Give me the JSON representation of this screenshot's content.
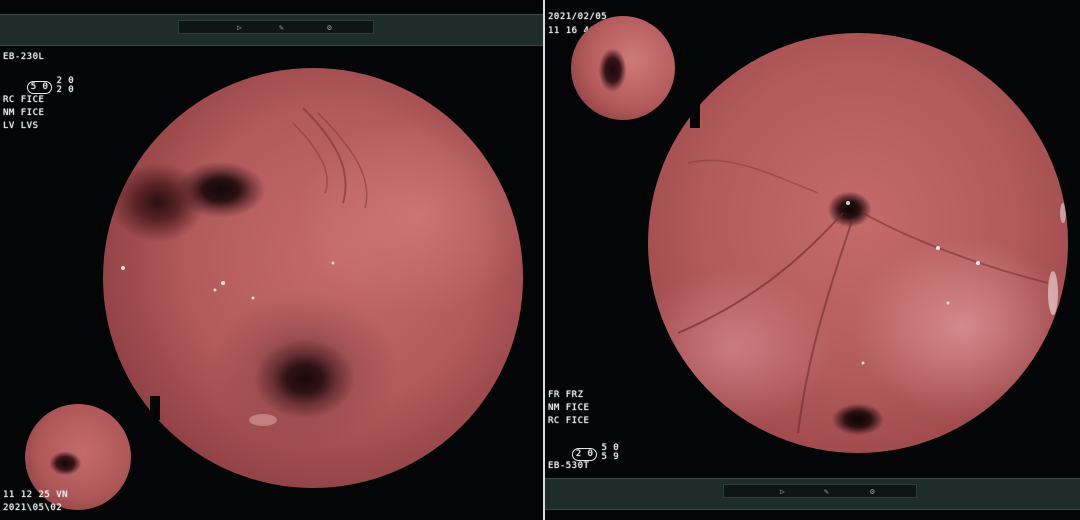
{
  "left_panel": {
    "scope_model": "EB-230L",
    "badge_value": "5 0",
    "badge_side": [
      "2 0",
      "2 0"
    ],
    "mode_lines": [
      "RC FICE",
      "NM FICE",
      "LV LVS"
    ],
    "time": "11 12 25 VN",
    "date": "2021\\05\\02"
  },
  "right_panel": {
    "date": "2021/02/05",
    "time": "11 16 46 AM",
    "mode_lines": [
      "FR FRZ",
      "NM FICE",
      "RC FICE"
    ],
    "badge_value": "2 0",
    "badge_side": [
      "5 0",
      "5 9"
    ],
    "scope_model": "EB-530T"
  },
  "colors": {
    "background": "#030506",
    "control_bar": "#1e2c2b",
    "osd_text": "#e6ecec",
    "mucosa": "#b85a5c",
    "lumen": "#1a0a0c"
  }
}
